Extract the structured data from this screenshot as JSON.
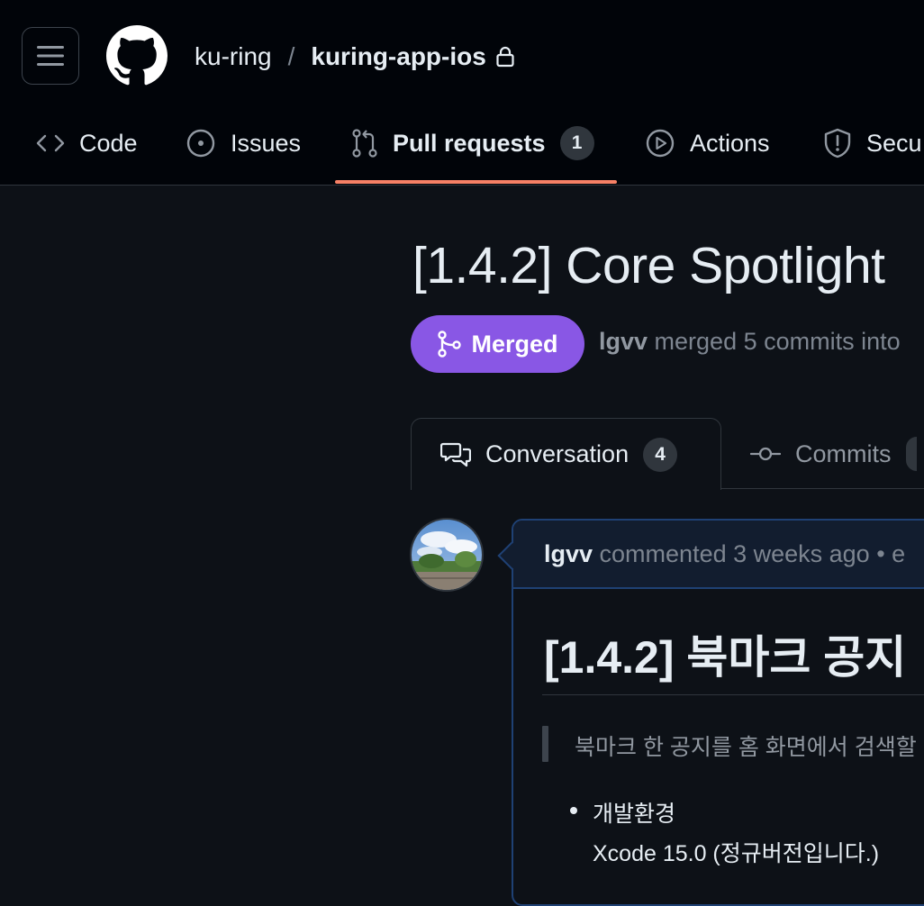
{
  "header": {
    "owner": "ku-ring",
    "separator": "/",
    "repo": "kuring-app-ios"
  },
  "tabs": [
    {
      "label": "Code",
      "icon": "code-icon"
    },
    {
      "label": "Issues",
      "icon": "issue-opened-icon"
    },
    {
      "label": "Pull requests",
      "icon": "git-pull-request-icon",
      "count": "1",
      "active": true
    },
    {
      "label": "Actions",
      "icon": "play-icon"
    },
    {
      "label": "Secu",
      "icon": "shield-icon"
    }
  ],
  "pr": {
    "title": "[1.4.2] Core Spotlight",
    "state": "Merged",
    "author": "lgvv",
    "meta_rest": " merged 5 commits into"
  },
  "subtabs": [
    {
      "label": "Conversation",
      "count": "4",
      "icon": "comment-discussion-icon"
    },
    {
      "label": "Commits",
      "icon": "git-commit-icon"
    }
  ],
  "comment": {
    "author": "lgvv",
    "meta": " commented 3 weeks ago • e",
    "heading": "[1.4.2] 북마크 공지",
    "quote": "북마크 한 공지를 홈 화면에서 검색할",
    "list_item": "개발환경",
    "list_sub": "Xcode 15.0 (정규버전입니다.)"
  },
  "colors": {
    "background": "#0d1117",
    "header_bg": "#010409",
    "merged": "#8957e5",
    "active_underline": "#f78166",
    "comment_border": "#1f4174"
  }
}
